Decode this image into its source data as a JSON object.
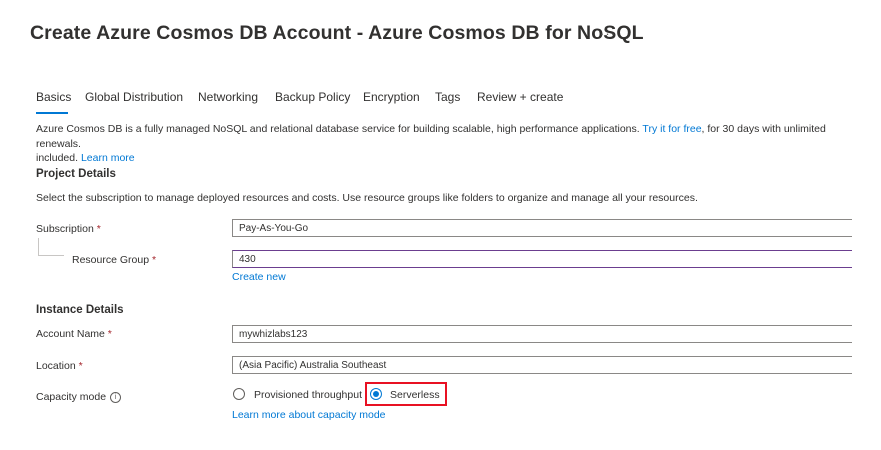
{
  "page": {
    "title": "Create Azure Cosmos DB Account - Azure Cosmos DB for NoSQL",
    "more_label": "···"
  },
  "tabs": [
    {
      "label": "Basics",
      "active": true
    },
    {
      "label": "Global Distribution",
      "active": false
    },
    {
      "label": "Networking",
      "active": false
    },
    {
      "label": "Backup Policy",
      "active": false
    },
    {
      "label": "Encryption",
      "active": false
    },
    {
      "label": "Tags",
      "active": false
    },
    {
      "label": "Review + create",
      "active": false
    }
  ],
  "intro": {
    "text_part1": "Azure Cosmos DB is a fully managed NoSQL and relational database service for building scalable, high performance applications. ",
    "try_link": "Try it for free",
    "text_part2": ", for 30 days with unlimited renewals.",
    "text_part3": "included. ",
    "learn_link": "Learn more"
  },
  "project_details": {
    "title": "Project Details",
    "description": "Select the subscription to manage deployed resources and costs. Use resource groups like folders to organize and manage all your resources.",
    "subscription_label": "Subscription",
    "subscription_value": "Pay-As-You-Go",
    "resource_group_label": "Resource Group",
    "resource_group_value": "430",
    "create_new_link": "Create new"
  },
  "instance_details": {
    "title": "Instance Details",
    "account_name_label": "Account Name",
    "account_name_value": "mywhizlabs123",
    "location_label": "Location",
    "location_value": "(Asia Pacific) Australia Southeast",
    "capacity_label": "Capacity mode",
    "info_icon": "i",
    "option_provisioned": "Provisioned throughput",
    "option_serverless": "Serverless",
    "selected": "Serverless",
    "learn_capacity_link": "Learn more about capacity mode"
  },
  "required_marker": "*",
  "colors": {
    "accent": "#0078d4",
    "required": "#a4262c",
    "highlight": "#e81123",
    "field_border_active": "#6b3e8f"
  }
}
